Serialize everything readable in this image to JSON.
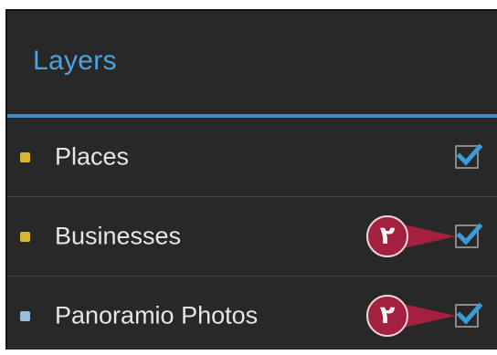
{
  "panel": {
    "title": "Layers",
    "accent_color": "#4aa3db",
    "background_color": "#282828"
  },
  "layers": [
    {
      "label": "Places",
      "checked": true,
      "icon": "yellow-square-icon",
      "icon_color": "#d9b735",
      "callout": ""
    },
    {
      "label": "Businesses",
      "checked": true,
      "icon": "yellow-square-icon",
      "icon_color": "#d9b735",
      "callout": "٢"
    },
    {
      "label": "Panoramio Photos",
      "checked": true,
      "icon": "blue-square-icon",
      "icon_color": "#9bbbe0",
      "callout": "٢"
    }
  ],
  "callout_color": "#a4203f"
}
